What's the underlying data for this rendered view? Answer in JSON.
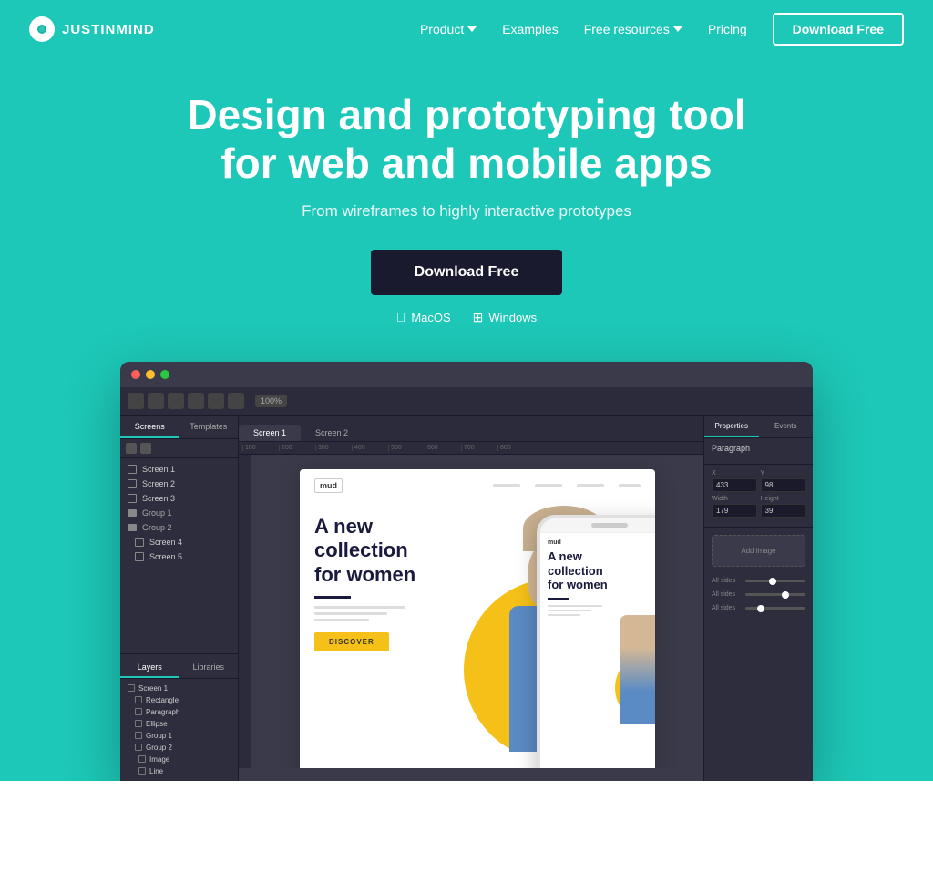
{
  "nav": {
    "logo_text": "JUSTINMIND",
    "links": [
      {
        "label": "Product",
        "has_dropdown": true
      },
      {
        "label": "Examples",
        "has_dropdown": false
      },
      {
        "label": "Free resources",
        "has_dropdown": true
      },
      {
        "label": "Pricing",
        "has_dropdown": false
      }
    ],
    "cta_label": "Download Free"
  },
  "hero": {
    "title_line1": "Design and prototyping tool",
    "title_line2": "for web and mobile apps",
    "subtitle": "From wireframes to highly interactive prototypes",
    "cta_label": "Download Free",
    "os_macos": "MacOS",
    "os_windows": "Windows"
  },
  "app": {
    "toolbar_zoom": "100%",
    "sidebar_tabs": [
      "Screens",
      "Templates"
    ],
    "screens": [
      "Screen 1",
      "Screen 2",
      "Screen 3"
    ],
    "groups": [
      "Group 1",
      "Group 2"
    ],
    "screens_in_group": [
      "Screen 4",
      "Screen 5"
    ],
    "canvas_tabs": [
      "Screen 1",
      "Screen 2"
    ],
    "layers_tabs": [
      "Layers",
      "Libraries"
    ],
    "layers": [
      "Screen 1",
      "Rectangle",
      "Paragraph",
      "Ellipse",
      "Group 1",
      "Group 2",
      "Image",
      "Line"
    ],
    "properties_tabs": [
      "Properties",
      "Events"
    ],
    "properties_title": "Paragraph",
    "props": {
      "x_label": "X",
      "x_value": "433",
      "y_label": "Y",
      "y_value": "98",
      "w_label": "Width",
      "w_value": "179",
      "h_label": "Height",
      "h_value": "39"
    }
  },
  "proto": {
    "logo": "mud",
    "heading_line1": "A new",
    "heading_line2": "collection",
    "heading_line3": "for women",
    "cta": "DISCOVER"
  },
  "phone": {
    "logo": "mud",
    "heading_line1": "A new",
    "heading_line2": "collection",
    "heading_line3": "for women"
  }
}
